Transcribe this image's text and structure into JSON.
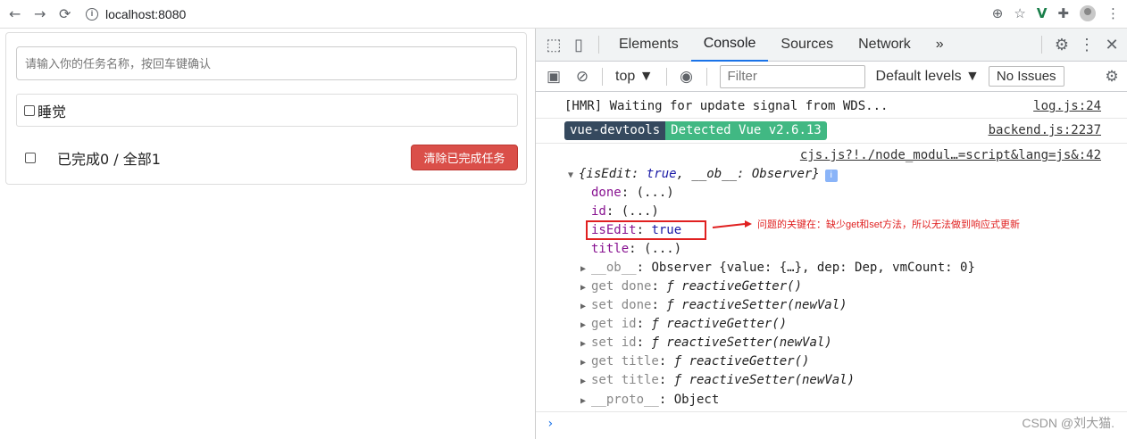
{
  "browser": {
    "url": "localhost:8080",
    "back_icon": "arrow-left-icon",
    "forward_icon": "arrow-right-icon",
    "reload_icon": "reload-icon"
  },
  "app": {
    "input_placeholder": "请输入你的任务名称，按回车键确认",
    "todo_items": [
      {
        "title": "睡觉",
        "done": false
      }
    ],
    "footer": {
      "stat_text": "已完成0 / 全部1",
      "clear_button": "清除已完成任务"
    },
    "colors": {
      "clear_button_bg": "#da4f49"
    }
  },
  "devtools": {
    "tabs": [
      "Elements",
      "Console",
      "Sources",
      "Network"
    ],
    "active_tab": "Console",
    "more_tabs": "»",
    "context": "top ▼",
    "filter_placeholder": "Filter",
    "levels": "Default levels ▼",
    "issues": "No Issues",
    "console_lines": {
      "hmr": "[HMR] Waiting for update signal from WDS...",
      "hmr_src": "log.js:24",
      "badge_left": "vue-devtools",
      "badge_right": "Detected Vue v2.6.13",
      "badge_src": "backend.js:2237",
      "obj_src": "cjs.js?!./node_modul…=script&lang=js&:42",
      "obj_summary_prefix": "{isEdit: ",
      "obj_summary_value": "true",
      "obj_summary_suffix": ", __ob__: Observer}",
      "props": [
        {
          "key": "done",
          "value": "(...)"
        },
        {
          "key": "id",
          "value": "(...)"
        },
        {
          "key": "isEdit",
          "value": "true"
        },
        {
          "key": "title",
          "value": "(...)"
        }
      ],
      "ob_line": {
        "key": "__ob__",
        "value": "Observer {value: {…}, dep: Dep, vmCount: 0}"
      },
      "accessors": [
        {
          "key": "get done",
          "value": "ƒ reactiveGetter()"
        },
        {
          "key": "set done",
          "value": "ƒ reactiveSetter(newVal)"
        },
        {
          "key": "get id",
          "value": "ƒ reactiveGetter()"
        },
        {
          "key": "set id",
          "value": "ƒ reactiveSetter(newVal)"
        },
        {
          "key": "get title",
          "value": "ƒ reactiveGetter()"
        },
        {
          "key": "set title",
          "value": "ƒ reactiveSetter(newVal)"
        }
      ],
      "proto_line": {
        "key": "__proto__",
        "value": "Object"
      },
      "prompt": "›"
    }
  },
  "annotation": "问题的关键在：缺少get和set方法，所以无法做到响应式更新",
  "watermark": "CSDN @刘大猫."
}
